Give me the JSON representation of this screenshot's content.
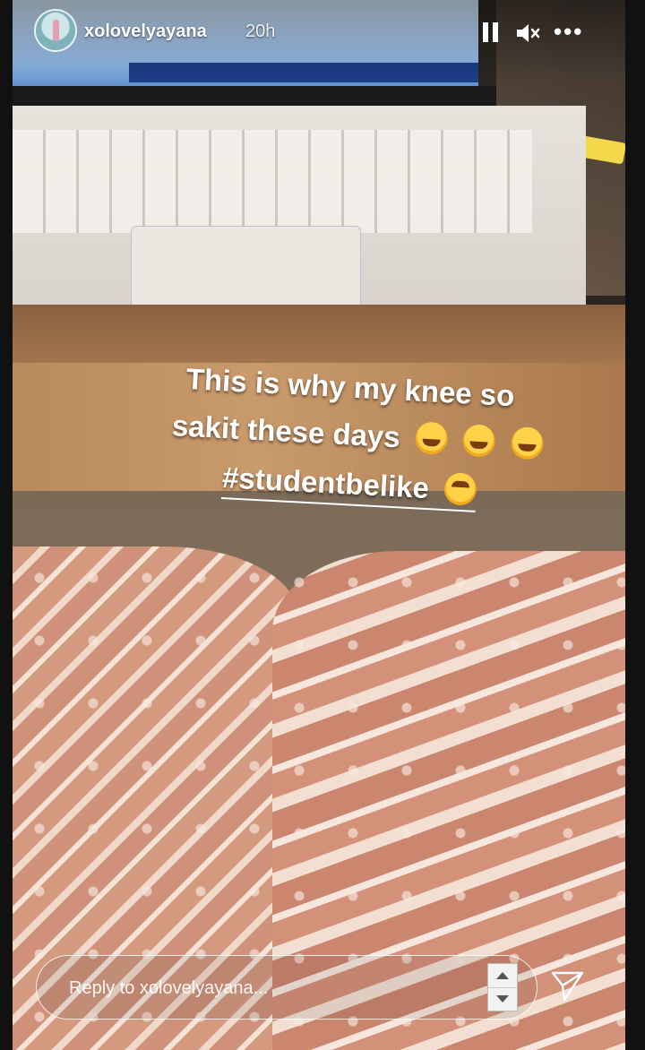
{
  "story": {
    "username": "xolovelyayana",
    "time_ago": "20h",
    "caption_lines": [
      "This is why my knee so",
      "sakit these days",
      "#studentbelike"
    ]
  },
  "controls": {
    "pause_icon": "pause-icon",
    "mute_icon": "speaker-muted-icon",
    "more_icon": "more-horizontal-icon",
    "more_glyph": "•••"
  },
  "reply": {
    "placeholder": "Reply to xolovelyayana..."
  },
  "colors": {
    "text": "#ffffff",
    "emoji": "#ffd24a"
  }
}
